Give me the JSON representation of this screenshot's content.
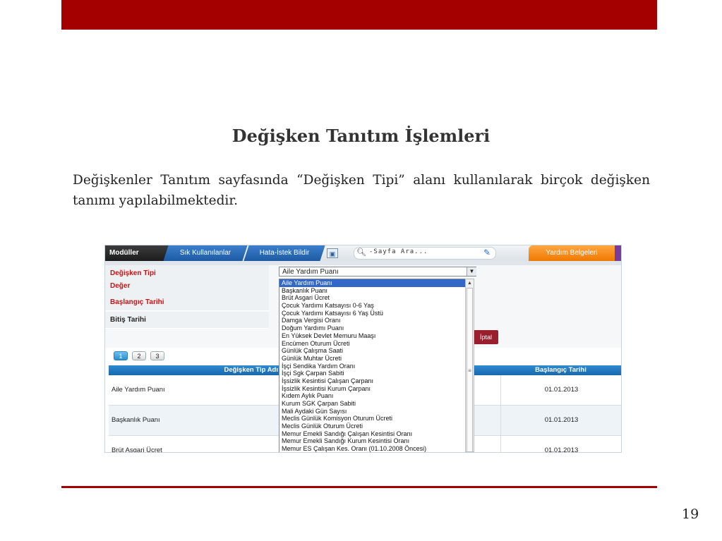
{
  "slide": {
    "title": "Değişken Tanıtım İşlemleri",
    "intro": "Değişkenler Tanıtım sayfasında “Değişken Tipi” alanı kullanılarak birçok değişken tanımı yapılabilmektedir.",
    "page_number": "19",
    "accent_color": "#a50000"
  },
  "screenshot": {
    "topnav": {
      "modules": "Modüller",
      "tab_frequent": "Sık Kullanılanlar",
      "tab_report": "Hata-İstek Bildir",
      "search_placeholder": "-Sayfa Ara...",
      "help": "Yardım Belgeleri"
    },
    "form": {
      "labels": [
        "Değişken Tipi",
        "Değer",
        "Başlangıç Tarihi",
        "Bitiş Tarihi"
      ],
      "select_value": "Aile Yardım Puanı",
      "cancel_button": "İptal"
    },
    "pager": [
      "1",
      "2",
      "3"
    ],
    "grid": {
      "headers": [
        "Değişken Tip Adı",
        "Başlangıç Tarihi"
      ],
      "rows": [
        {
          "name": "Aile Yardım Puanı",
          "date": "01.01.2013"
        },
        {
          "name": "Başkanlık Puanı",
          "date": "01.01.2013"
        },
        {
          "name": "Brüt Asgari Ücret",
          "date": "01.01.2013"
        }
      ]
    },
    "dropdown_options": [
      "Aile Yardım Puanı",
      "Başkanlık Puanı",
      "Brüt Asgari Ücret",
      "Çocuk Yardımı Katsayısı 0-6 Yaş",
      "Çocuk Yardımı Katsayısı 6 Yaş Üstü",
      "Damga Vergisi Oranı",
      "Doğum Yardımı Puanı",
      "En Yüksek Devlet Memuru Maaşı",
      "Encümen Oturum Ücreti",
      "Günlük Çalışma Saati",
      "Günlük Muhtar Ücreti",
      "İşçi Sendika Yardım Oranı",
      "İşçi Sgk Çarpan Sabiti",
      "İşsizlik Kesintisi Çalışan Çarpanı",
      "İşsizlik Kesintisi Kurum Çarpanı",
      "Kıdem Aylık Puanı",
      "Kurum SGK Çarpan Sabiti",
      "Mali Aydaki Gün Sayısı",
      "Meclis Günlük Komisyon Oturum Ücreti",
      "Meclis Günlük Oturum Ücreti",
      "Memur Emekli Sandığı Çalışan Kesintisi Oranı",
      "Memur Emekli Sandığı Kurum Kesintisi Oranı",
      "Memur ES Çalışan Kes. Oranı (01.10.2008 Öncesi)"
    ]
  }
}
